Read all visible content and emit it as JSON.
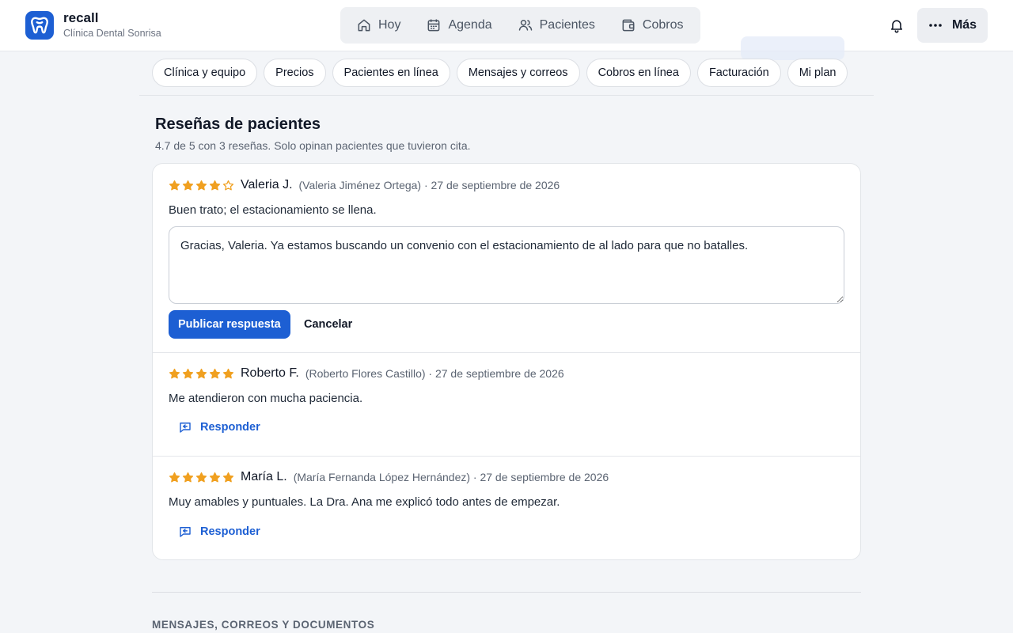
{
  "app": {
    "name": "recall",
    "clinic": "Clínica Dental Sonrisa"
  },
  "nav": [
    {
      "label": "Hoy",
      "icon": "home-icon"
    },
    {
      "label": "Agenda",
      "icon": "calendar-icon"
    },
    {
      "label": "Pacientes",
      "icon": "users-icon"
    },
    {
      "label": "Cobros",
      "icon": "wallet-icon"
    }
  ],
  "header": {
    "more_label": "Más",
    "bell_icon": "bell-icon",
    "more_icon": "dots-icon"
  },
  "tabs": [
    "Clínica y equipo",
    "Precios",
    "Pacientes en línea",
    "Mensajes y correos",
    "Cobros en línea",
    "Facturación",
    "Mi plan"
  ],
  "reviews_section": {
    "title": "Reseñas de pacientes",
    "subtitle": "4.7 de 5 con 3 reseñas. Solo opinan pacientes que tuvieron cita."
  },
  "reviews": [
    {
      "rating": 4,
      "name": "Valeria J.",
      "meta": "(Valeria Jiménez Ortega) · 27 de septiembre de 2026",
      "text": "Buen trato; el estacionamiento se llena.",
      "reply_draft": "Gracias, Valeria. Ya estamos buscando un convenio con el estacionamiento de al lado para que no batalles.",
      "publish_label": "Publicar respuesta",
      "cancel_label": "Cancelar"
    },
    {
      "rating": 5,
      "name": "Roberto F.",
      "meta": "(Roberto Flores Castillo) · 27 de septiembre de 2026",
      "text": "Me atendieron con mucha paciencia.",
      "reply_label": "Responder"
    },
    {
      "rating": 5,
      "name": "María L.",
      "meta": "(María Fernanda López Hernández) · 27 de septiembre de 2026",
      "text": "Muy amables y puntuales. La Dra. Ana me explicó todo antes de empezar.",
      "reply_label": "Responder"
    }
  ],
  "next_section": {
    "title": "MENSAJES, CORREOS Y DOCUMENTOS"
  },
  "colors": {
    "accent": "#1d5fd3",
    "star": "#f0a020",
    "background": "#f3f5f8"
  }
}
